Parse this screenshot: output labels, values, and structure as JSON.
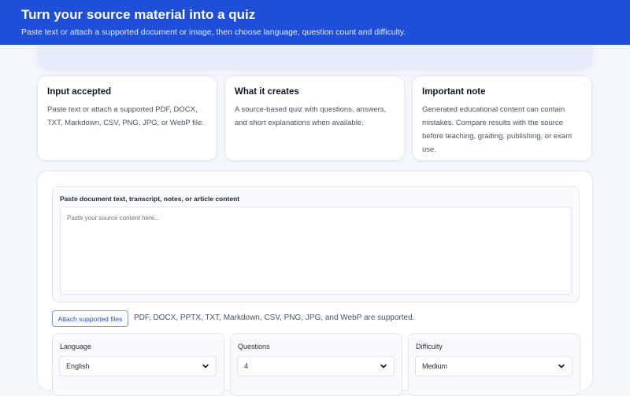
{
  "header": {
    "title": "Turn your source material into a quiz",
    "subtitle": "Paste text or attach a supported document or image, then choose language, question count and difficulty."
  },
  "cards": [
    {
      "title": "Input accepted",
      "body": "Paste text or attach a supported PDF, DOCX, TXT, Markdown, CSV, PNG, JPG, or WebP file."
    },
    {
      "title": "What it creates",
      "body": "A source-based quiz with questions, answers, and short explanations when available."
    },
    {
      "title": "Important note",
      "body": "Generated educational content can contain mistakes. Compare results with the source before teaching, grading, publishing, or exam use."
    }
  ],
  "source": {
    "label": "Paste document text, transcript, notes, or article content",
    "placeholder": "Paste your source content here...",
    "value": ""
  },
  "attach": {
    "button_label": "Attach supported files",
    "note": "PDF, DOCX, PPTX, TXT, Markdown, CSV, PNG, JPG, and WebP are supported."
  },
  "options": {
    "language": {
      "label": "Language",
      "value": "English"
    },
    "questions": {
      "label": "Questions",
      "value": "4"
    },
    "difficulty": {
      "label": "Difficulty",
      "value": "Medium"
    }
  },
  "colors": {
    "header_bg": "#1f4fd8",
    "accent": "#1f4fd8",
    "page_bg": "#f3f6fb"
  },
  "icons": {
    "select_indicator": "chevron-down-icon"
  }
}
